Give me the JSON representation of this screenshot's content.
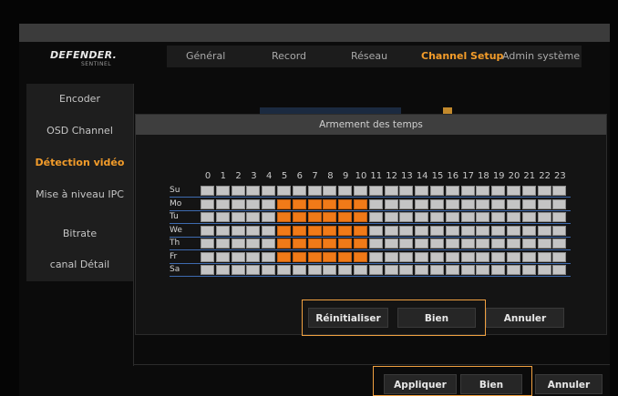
{
  "logo": {
    "brand": "DEFENDER.",
    "sub": "SENTINEL"
  },
  "tabs": [
    {
      "label": "Général",
      "active": false
    },
    {
      "label": "Record",
      "active": false
    },
    {
      "label": "Réseau",
      "active": false
    },
    {
      "label": "Channel Setup",
      "active": true
    },
    {
      "label": "Admin système",
      "active": false
    }
  ],
  "sidebar": {
    "items": [
      {
        "label": "Encoder",
        "active": false
      },
      {
        "label": "OSD Channel",
        "active": false
      },
      {
        "label": "Détection vidéo",
        "active": true
      },
      {
        "label": "Mise à niveau IPC",
        "active": false
      },
      {
        "label": "Bitrate",
        "active": false
      },
      {
        "label": "canal Détail",
        "active": false
      }
    ]
  },
  "dialog": {
    "title": "Armement des temps",
    "hours": [
      "0",
      "1",
      "2",
      "3",
      "4",
      "5",
      "6",
      "7",
      "8",
      "9",
      "10",
      "11",
      "12",
      "13",
      "14",
      "15",
      "16",
      "17",
      "18",
      "19",
      "20",
      "21",
      "22",
      "23"
    ],
    "days": [
      "Su",
      "Mo",
      "Tu",
      "We",
      "Th",
      "Fr",
      "Sa"
    ],
    "schedule_armed": {
      "Mo": [
        5,
        6,
        7,
        8,
        9,
        10
      ],
      "Tu": [
        5,
        6,
        7,
        8,
        9,
        10
      ],
      "We": [
        5,
        6,
        7,
        8,
        9,
        10
      ],
      "Th": [
        5,
        6,
        7,
        8,
        9,
        10
      ],
      "Fr": [
        5,
        6,
        7,
        8,
        9,
        10
      ]
    },
    "buttons": {
      "reset": "Réinitialiser",
      "ok": "Bien",
      "cancel": "Annuler"
    }
  },
  "footer": {
    "apply": "Appliquer",
    "ok": "Bien",
    "cancel": "Annuler"
  },
  "colors": {
    "accent": "#f39c2a",
    "armed": "#f07a18",
    "unarmed": "#c4c4c4",
    "highlight": "#f0a040"
  }
}
